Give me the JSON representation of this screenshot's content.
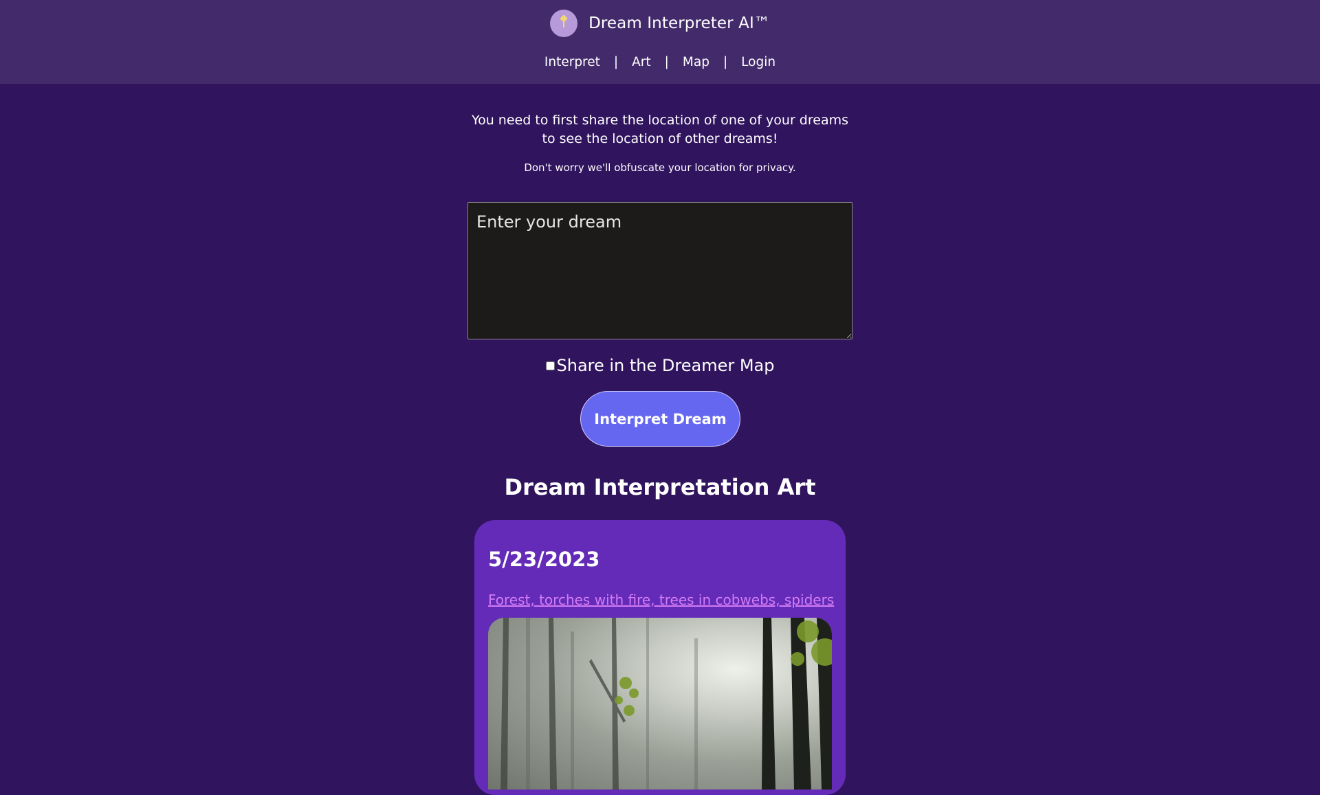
{
  "header": {
    "app_name": "Dream Interpreter AI™",
    "logo_icon": "lightbulb-icon",
    "nav": {
      "interpret": "Interpret",
      "art": "Art",
      "map": "Map",
      "login": "Login",
      "separator": "|"
    }
  },
  "notice": {
    "line1": "You need to first share the location of one of your dreams",
    "line2": "to see the location of other dreams!",
    "privacy": "Don't worry we'll obfuscate your location for privacy."
  },
  "form": {
    "dream_placeholder": "Enter your dream",
    "dream_value": "",
    "share_label": "Share in the Dreamer Map",
    "share_checked": false,
    "submit_label": "Interpret Dream"
  },
  "art": {
    "heading": "Dream Interpretation Art",
    "cards": [
      {
        "date": "5/23/2023",
        "title": "Forest, torches with fire, trees in cobwebs, spiders"
      }
    ]
  },
  "colors": {
    "page_bg": "#30145e",
    "header_bg": "#432b6b",
    "button_bg": "#6667f0",
    "card_bg": "#632bb7",
    "link": "#d47cf6"
  }
}
